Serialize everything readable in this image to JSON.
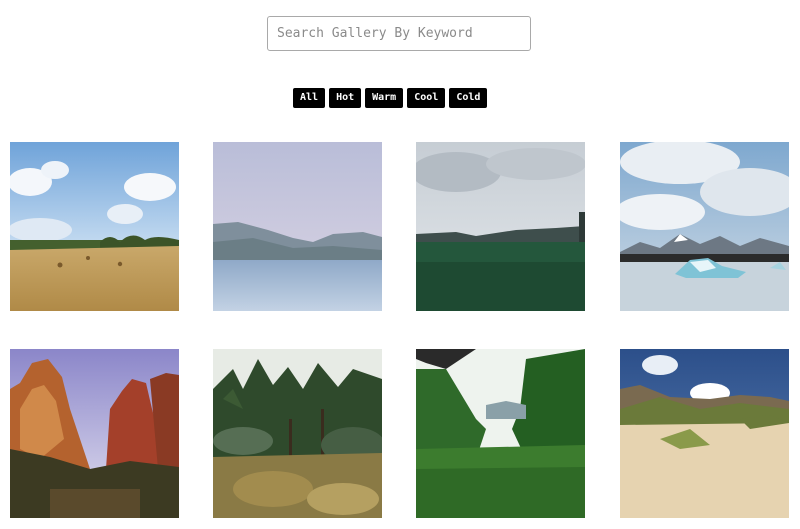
{
  "search": {
    "placeholder": "Search Gallery By Keyword",
    "value": ""
  },
  "filters": [
    "All",
    "Hot",
    "Warm",
    "Cool",
    "Cold"
  ],
  "gallery": [
    {
      "scene": "hay field under blue sky"
    },
    {
      "scene": "calm lake with misty hills"
    },
    {
      "scene": "green marsh under cloudy sky"
    },
    {
      "scene": "glacier lagoon with icebergs"
    },
    {
      "scene": "red canyon cliffs"
    },
    {
      "scene": "overgrown garden with trees"
    },
    {
      "scene": "green forest clearing"
    },
    {
      "scene": "sand dunes with grass"
    }
  ]
}
